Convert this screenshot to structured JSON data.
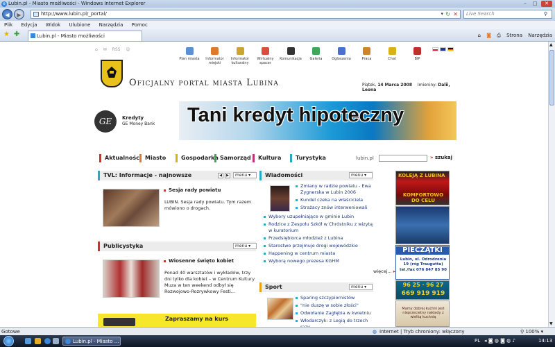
{
  "window": {
    "title": "Lubin.pl - Miasto możliwości - Windows Internet Explorer",
    "url": "http://www.lubin.pl/_portal/",
    "search_placeholder": "Live Search",
    "menu": [
      "Plik",
      "Edycja",
      "Widok",
      "Ulubione",
      "Narzędzia",
      "Pomoc"
    ],
    "tab_label": "Lubin.pl - Miasto możliwości",
    "tab_tools": [
      "Strona",
      "Narzędzia"
    ],
    "status_left": "Gotowe",
    "status_zone": "Internet | Tryb chroniony: włączony",
    "zoom": "100%",
    "task_label": "Lubin.pl - Miasto ...",
    "taskbar_lang": "PL",
    "clock": "14:13"
  },
  "site": {
    "util_links": [
      "RSS"
    ],
    "top_icons": [
      {
        "label": "Plan miasta",
        "color": "#5b8fd6"
      },
      {
        "label": "Informator miejski",
        "color": "#e07a2a"
      },
      {
        "label": "Informator kulturalny",
        "color": "#c9a72f"
      },
      {
        "label": "Wirtualny spacer",
        "color": "#d94f3d"
      },
      {
        "label": "Komunikacja",
        "color": "#333333"
      },
      {
        "label": "Galeria",
        "color": "#3fa65a"
      },
      {
        "label": "Ogłoszenia",
        "color": "#4a6fd0"
      },
      {
        "label": "Praca",
        "color": "#d0842a"
      },
      {
        "label": "Chat",
        "color": "#d8b018"
      },
      {
        "label": "BIP",
        "color": "#c0302a"
      }
    ],
    "portal_title": "Oficjalny portal miasta Lubina",
    "date_prefix": "Piątek,",
    "date_value": "14 Marca 2008",
    "nameday_prefix": "Imieniny:",
    "nameday_value": "Dalii, Leona",
    "banner": {
      "brand_top": "Kredyty",
      "brand_bottom": "GE Money Bank",
      "headline": "Tani kredyt hipoteczny",
      "logo_text": "GE"
    },
    "categories": [
      {
        "label": "Aktualności",
        "color": "#d0302a"
      },
      {
        "label": "Miasto",
        "color": "#e07a2a"
      },
      {
        "label": "Gospodarka",
        "color": "#d8b018"
      },
      {
        "label": "Samorząd",
        "color": "#3fa65a"
      },
      {
        "label": "Kultura",
        "color": "#c0307a"
      },
      {
        "label": "Turystyka",
        "color": "#2aa8c8"
      }
    ],
    "search_label": "lubin.pl",
    "search_button": "szukaj",
    "tvl": {
      "header": "TVL: Informacje - najnowsze",
      "menu_label": "menu",
      "headline": "Sesja rady powiatu",
      "body": "LUBIN. Sesja rady powiatu. Tym razem mówiono o drogach."
    },
    "publicystyka": {
      "header": "Publicystyka",
      "menu_label": "menu",
      "headline": "Wiosenne święto kobiet",
      "body": "Ponad 40 warsztatów i wykładów, trzy dni tylko dla kobiet – w Centrum Kultury Muza w ten weekend odbył się Rozwojowo-Rozrywkowy Festi..."
    },
    "courses_label": "Zapraszamy na kurs",
    "wiadomosci": {
      "header": "Wiadomości",
      "menu_label": "menu",
      "items_with_image": [
        "Zmiany w radzie powiatu - Ewa Zygnerska w Lubin 2006",
        "Kundel czeka na właściciela",
        "Strażacy znów interweniowali"
      ],
      "items": [
        "Wybory uzupełniające w gminie Lubin",
        "Rodzice z Zespołu Szkół w Chróstniku z wizytą w kuratorium",
        "Przedsiębiorca młodzież z Lubina",
        "Starostwo przejmuje drogi wojewódzkie",
        "Happening w centrum miasta",
        "Wyborą nowego prezesa KGHM"
      ],
      "more": "więcej..."
    },
    "sport": {
      "header": "Sport",
      "menu_label": "menu",
      "items": [
        "Sparing szczypiornistów",
        "\"nie duszę w sobie złości\"",
        "Odwołanie Zagłębia w kwietniu",
        "Włodarczyk: z Legią do trzech razy"
      ]
    },
    "ads": {
      "kolej_title": "KOLEJĄ Z LUBINA",
      "kolej_sub": "KOMFORTOWO DO CELU",
      "pieczatki_title": "PIECZĄTKI",
      "pieczatki_addr": "Lubin, ul. Odrodzenia 19 (róg Traugutta)",
      "pieczatki_tel": "tel./fax 076 847 85 90",
      "phone_pair": "96 25 · 96 27",
      "phone_big": "669 919 919",
      "kuchnia_text": "Mamy dobrej kuchni jest nieprzecietny nakłady z wielką kuchnią"
    }
  }
}
